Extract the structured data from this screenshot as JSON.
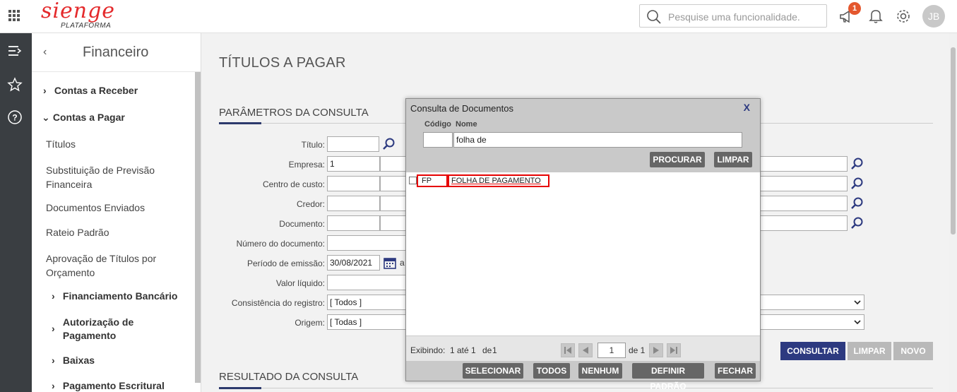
{
  "topbar": {
    "logo_text": "sienge",
    "logo_sub": "PLATAFORMA",
    "search_placeholder": "Pesquise uma funcionalidade.",
    "notification_count": "1",
    "avatar_initials": "JB"
  },
  "sidebar": {
    "title": "Financeiro",
    "items": [
      {
        "label": "Contas a Receber",
        "bold": true,
        "chevron": "right"
      },
      {
        "label": "Contas a Pagar",
        "bold": true,
        "chevron": "down"
      },
      {
        "label": "Títulos"
      },
      {
        "label": "Substituição de Previsão",
        "label2": "Financeira"
      },
      {
        "label": "Documentos Enviados"
      },
      {
        "label": "Rateio Padrão"
      },
      {
        "label": "Aprovação de Títulos por",
        "label2": "Orçamento"
      },
      {
        "label": "Financiamento Bancário",
        "bold": true,
        "chevron": "right"
      },
      {
        "label": "Autorização de",
        "label2": "Pagamento",
        "bold": true,
        "chevron": "right"
      },
      {
        "label": "Baixas",
        "bold": true,
        "chevron": "right"
      },
      {
        "label": "Pagamento Escritural",
        "bold": true,
        "chevron": "right"
      }
    ]
  },
  "main": {
    "page_title": "TÍTULOS A PAGAR",
    "params_title": "PARÂMETROS DA CONSULTA",
    "results_title": "RESULTADO DA CONSULTA",
    "fields": {
      "titulo": {
        "label": "Título:",
        "value": ""
      },
      "empresa": {
        "label": "Empresa:",
        "value": "1"
      },
      "centro_custo": {
        "label": "Centro de custo:",
        "value": ""
      },
      "credor": {
        "label": "Credor:",
        "value": ""
      },
      "documento": {
        "label": "Documento:",
        "value": ""
      },
      "numero_documento": {
        "label": "Número do documento:",
        "value": ""
      },
      "periodo_emissao": {
        "label": "Período de emissão:",
        "value": "30/08/2021",
        "sep": "a"
      },
      "valor_liquido": {
        "label": "Valor líquido:",
        "value": ""
      },
      "consistencia": {
        "label": "Consistência do registro:",
        "value": "[ Todos ]"
      },
      "origem": {
        "label": "Origem:",
        "value": "[ Todas ]"
      }
    },
    "buttons": {
      "consultar": "CONSULTAR",
      "limpar": "LIMPAR",
      "novo": "NOVO"
    }
  },
  "modal": {
    "title": "Consulta de Documentos",
    "close": "X",
    "col_codigo": "Código",
    "col_nome": "Nome",
    "codigo_value": "",
    "nome_value": "folha de",
    "procurar": "PROCURAR",
    "limpar": "LIMPAR",
    "results": [
      {
        "code": "FP",
        "name": "FOLHA DE PAGAMENTO"
      }
    ],
    "footer": {
      "exibindo": "Exibindo:",
      "range": "1 até 1",
      "de": "de",
      "total": "1",
      "page": "1",
      "page_of": "de 1"
    },
    "actions": {
      "selecionar": "SELECIONAR",
      "todos": "TODOS",
      "nenhum": "NENHUM",
      "definir_padrao": "DEFINIR PADRÃO",
      "fechar": "FECHAR"
    }
  },
  "colors": {
    "brand": "#e4292b",
    "primary": "#2d3a80",
    "rail": "#3a3e42",
    "highlight": "#e60000"
  }
}
